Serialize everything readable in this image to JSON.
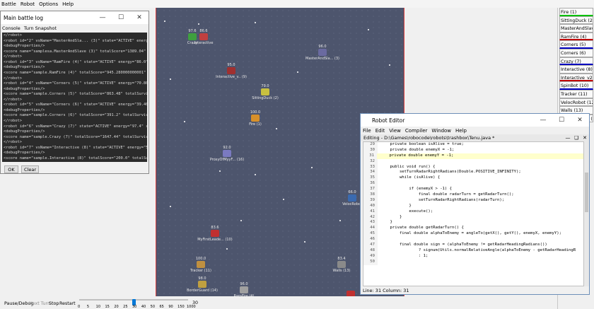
{
  "main_menu": [
    "Battle",
    "Robot",
    "Options",
    "Help"
  ],
  "arena": {
    "robots": [
      {
        "energy": "97.6",
        "label": "Crazy",
        "color": "#3fa03f"
      },
      {
        "energy": "86.6",
        "label": "Interactive",
        "color": "#c04040"
      },
      {
        "energy": "96.0",
        "label": "MasterAndSla... (3)",
        "color": "#6a6aa0"
      },
      {
        "energy": "95.0",
        "label": "Interactive_v.. (9)",
        "color": "#a03030"
      },
      {
        "energy": "79.0",
        "label": "SittingDuck (2)",
        "color": "#c8c040"
      },
      {
        "energy": "100.0",
        "label": "Fire (1)",
        "color": "#d8902a"
      },
      {
        "energy": "92.0",
        "label": "ProxyOfMyyF... (16)",
        "color": "#7a7ac0"
      },
      {
        "energy": "66.0",
        "label": "VelocRobot",
        "color": "#3a6ab0"
      },
      {
        "energy": "83.6",
        "label": "MyFirstLeade... (10)",
        "color": "#c03030"
      },
      {
        "energy": "100.0",
        "label": "Tracker (11)",
        "color": "#c09040"
      },
      {
        "energy": "98.0",
        "label": "BorderGuard (14)",
        "color": "#c0a040"
      },
      {
        "energy": "96.0",
        "label": "RamFire (4)",
        "color": "#a0a0a0"
      },
      {
        "energy": "83.4",
        "label": "Walls (13)",
        "color": "#8a8a8a"
      },
      {
        "energy": "",
        "label": "",
        "color": "#c03030"
      }
    ]
  },
  "robot_list": [
    {
      "label": "Fire (1)",
      "color": "#000000",
      "underline": "#00c000"
    },
    {
      "label": "SittingDuck (2)",
      "color": "#000000",
      "underline": ""
    },
    {
      "label": "MasterAndSlave...",
      "color": "#000000",
      "underline": ""
    },
    {
      "label": "RamFire (4)",
      "color": "#000000",
      "underline": "#c00000"
    },
    {
      "label": "Corners (5)",
      "color": "#000000",
      "underline": "#0000c0"
    },
    {
      "label": "Corners (6)",
      "color": "#000000",
      "underline": ""
    },
    {
      "label": "Crazy (7)",
      "color": "#000000",
      "underline": "#0000c0"
    },
    {
      "label": "Interactive (8)",
      "color": "#000000",
      "underline": ""
    },
    {
      "label": "Interactive_v2 (9)",
      "color": "#000000",
      "underline": "#c00000"
    },
    {
      "label": "SpinBot (10)",
      "color": "#000000",
      "underline": "#0000c0"
    },
    {
      "label": "Tracker (11)",
      "color": "#000000",
      "underline": ""
    },
    {
      "label": "VelocRobot (12)",
      "color": "#000000",
      "underline": ""
    },
    {
      "label": "Walls (13)",
      "color": "#000000",
      "underline": ""
    },
    {
      "label": "BorderGuard (14)",
      "color": "#000000",
      "underline": ""
    }
  ],
  "battle_log": {
    "title": "Main battle log",
    "tabs": [
      "Console",
      "Turn Snapshot"
    ],
    "lines": [
      "</robot>",
      "<robot id=\"2\" vsName=\"MasterAndSla... (3)\" state=\"ACTIVE\" energy",
      "<debugProperties/>",
      "<score name=\"samplesa.MasterAndSlave (3)\" totalScore=\"1389.04\" t",
      "</robot>",
      "<robot id=\"3\" vsName=\"RamFire (4)\" state=\"ACTIVE\" energy=\"86.0\"",
      "<debugProperties/>",
      "<score name=\"sample.RamFire (4)\" totalScore=\"945.280000000001\"",
      "</robot>",
      "<robot id=\"4\" vsName=\"Corners (5)\" state=\"ACTIVE\" energy=\"70.800",
      "<debugProperties/>",
      "<score name=\"sample.Corners (5)\" totalScore=\"863.48\" totalSurviv",
      "</robot>",
      "<robot id=\"5\" vsName=\"Corners (6)\" state=\"ACTIVE\" energy=\"39.400",
      "<debugProperties/>",
      "<score name=\"sample.Corners (6)\" totalScore=\"391.2\" totalSurviva",
      "</robot>",
      "<robot id=\"6\" vsName=\"Crazy (7)\" state=\"ACTIVE\" energy=\"97.4\" x=",
      "<debugProperties/>",
      "<score name=\"sample.Crazy (7)\" totalScore=\"1647.44\" totalSurviva",
      "</robot>",
      "<robot id=\"7\" vsName=\"Interactive (8)\" state=\"ACTIVE\" energy=\"59",
      "<debugProperties/>",
      "<score name=\"sample.Interactive (8)\" totalScore=\"200.0\" totalSur",
      "</robot>"
    ],
    "ok_label": "OK",
    "clear_label": "Clear"
  },
  "editor": {
    "title": "Robot Editor",
    "menu": [
      "File",
      "Edit",
      "View",
      "Compiler",
      "Window",
      "Help"
    ],
    "file_tab": "Editing - D:\\Games\\robocode\\robots\\trashbox\\Tenu.java *",
    "lines": [
      {
        "n": "29",
        "t": "    private boolean isAlive = true;"
      },
      {
        "n": "30",
        "t": "    private double enemyX = -1;"
      },
      {
        "n": "31",
        "t": "    private double enemyY = -1;"
      },
      {
        "n": "32",
        "t": ""
      },
      {
        "n": "33",
        "t": "    public void run() {"
      },
      {
        "n": "34",
        "t": "        setTurnRadarRightRadians(Double.POSITIVE_INFINITY);"
      },
      {
        "n": "35",
        "t": "        while (isAlive) {"
      },
      {
        "n": "36",
        "t": ""
      },
      {
        "n": "37",
        "t": "            if (enemyX > -1) {"
      },
      {
        "n": "38",
        "t": "                final double radarTurn = getRadarTurn();"
      },
      {
        "n": "39",
        "t": "                setTurnRadarRightRadians(radarTurn);"
      },
      {
        "n": "40",
        "t": "            }"
      },
      {
        "n": "41",
        "t": "            execute();"
      },
      {
        "n": "42",
        "t": "        }"
      },
      {
        "n": "43",
        "t": "    }"
      },
      {
        "n": "44",
        "t": "    private double getRadarTurn() {"
      },
      {
        "n": "45",
        "t": "        final double alphaToEnemy = angleTo(getX(), getY(), enemyX, enemyY);"
      },
      {
        "n": "46",
        "t": ""
      },
      {
        "n": "47",
        "t": "        final double sign = (alphaToEnemy != getRadarHeadingRadians())"
      },
      {
        "n": "48",
        "t": "                ? signum(Utils.normalRelativeAngle(alphaToEnemy - getRadarHeadingR"
      },
      {
        "n": "49",
        "t": "                : 1;"
      },
      {
        "n": "50",
        "t": ""
      }
    ],
    "status": "Line: 31 Column: 31"
  },
  "bottom_bar": {
    "pause_label": "Pause/Debug",
    "next_turn_label": "Next Turn",
    "stop_label": "Stop",
    "restart_label": "Restart",
    "tps_ticks": [
      "0",
      "5",
      "10",
      "15",
      "20",
      "25",
      "30",
      "40",
      "50",
      "65",
      "90",
      "150",
      "1000"
    ],
    "tps_value": "30",
    "tps_fraction": 0.5
  }
}
